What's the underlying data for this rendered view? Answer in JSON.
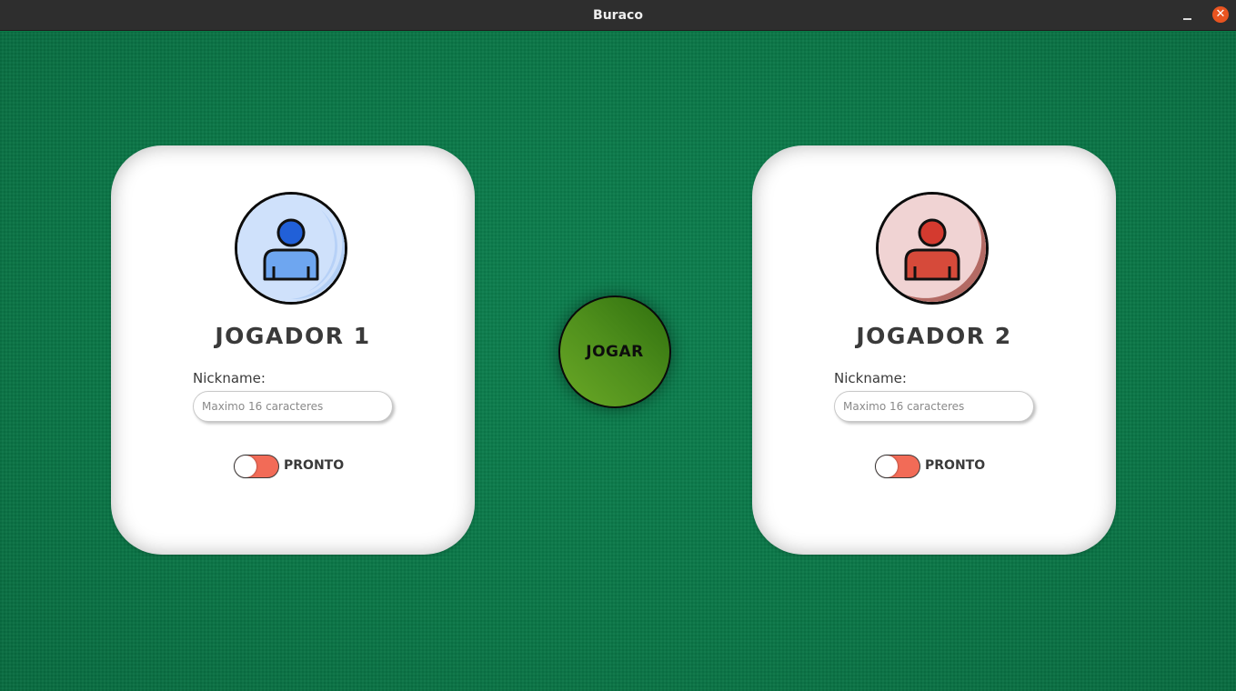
{
  "window": {
    "title": "Buraco",
    "minimize_symbol": "–",
    "close_symbol": "✕"
  },
  "players": [
    {
      "title": "JOGADOR 1",
      "nickname_label": "Nickname:",
      "nickname_value": "",
      "nickname_placeholder": "Maximo 16 caracteres",
      "ready_label": "PRONTO",
      "ready": false,
      "avatar_icon": "user-icon",
      "color": "#2160d8"
    },
    {
      "title": "JOGADOR 2",
      "nickname_label": "Nickname:",
      "nickname_value": "",
      "nickname_placeholder": "Maximo 16 caracteres",
      "ready_label": "PRONTO",
      "ready": false,
      "avatar_icon": "user-icon",
      "color": "#d43a2f"
    }
  ],
  "play_button": {
    "label": "JOGAR"
  },
  "colors": {
    "felt": "#0a7a47",
    "toggle_off": "#f26b57",
    "play_button": "#4f8f1c"
  }
}
